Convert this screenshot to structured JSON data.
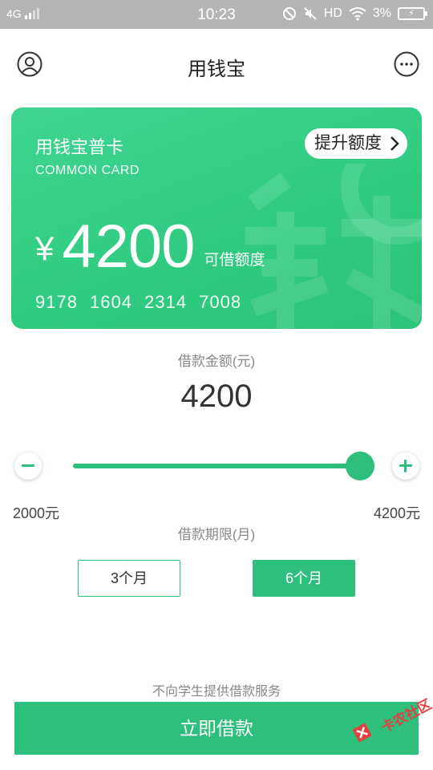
{
  "status_bar": {
    "network": "4G",
    "time": "10:23",
    "hd": "HD",
    "battery": "3%"
  },
  "header": {
    "title": "用钱宝",
    "left_icon": "user-icon",
    "right_icon": "more-icon"
  },
  "card": {
    "title": "用钱宝普卡",
    "subtitle": "COMMON CARD",
    "upgrade_label": "提升额度",
    "currency": "¥",
    "amount": "4200",
    "amount_label": "可借额度",
    "card_number": "9178 1604 2314 7008",
    "color_top": "#3fd591",
    "color_bottom": "#2cc37a"
  },
  "loan": {
    "amount_label": "借款金额(元)",
    "amount_value": "4200",
    "min_label": "2000元",
    "max_label": "4200元",
    "slider_fraction": 1.0
  },
  "term": {
    "label": "借款期限(月)",
    "options": [
      "3个月",
      "6个月"
    ],
    "selected": "6个月"
  },
  "footer": {
    "notice": "不向学生提供借款服务",
    "button_label": "立即借款",
    "watermark_text": "卡农社区"
  },
  "colors": {
    "accent": "#2ebf7c",
    "status_bar": "#b5b5b5"
  }
}
